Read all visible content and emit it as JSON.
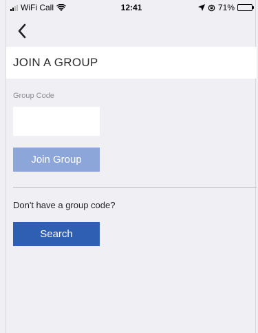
{
  "status_bar": {
    "carrier": "WiFi Call",
    "time": "12:41",
    "battery": "71%",
    "battery_level": 0.71
  },
  "header": {
    "back_icon": "chevron-left-icon",
    "title": "JOIN A GROUP"
  },
  "form": {
    "group_code_label": "Group Code",
    "group_code_value": "",
    "join_button": "Join Group"
  },
  "alternate": {
    "prompt": "Don't have a group code?",
    "search_button": "Search"
  },
  "colors": {
    "background": "#f0eff4",
    "join_button_disabled": "#8da6d9",
    "search_button": "#2f5fb2"
  }
}
